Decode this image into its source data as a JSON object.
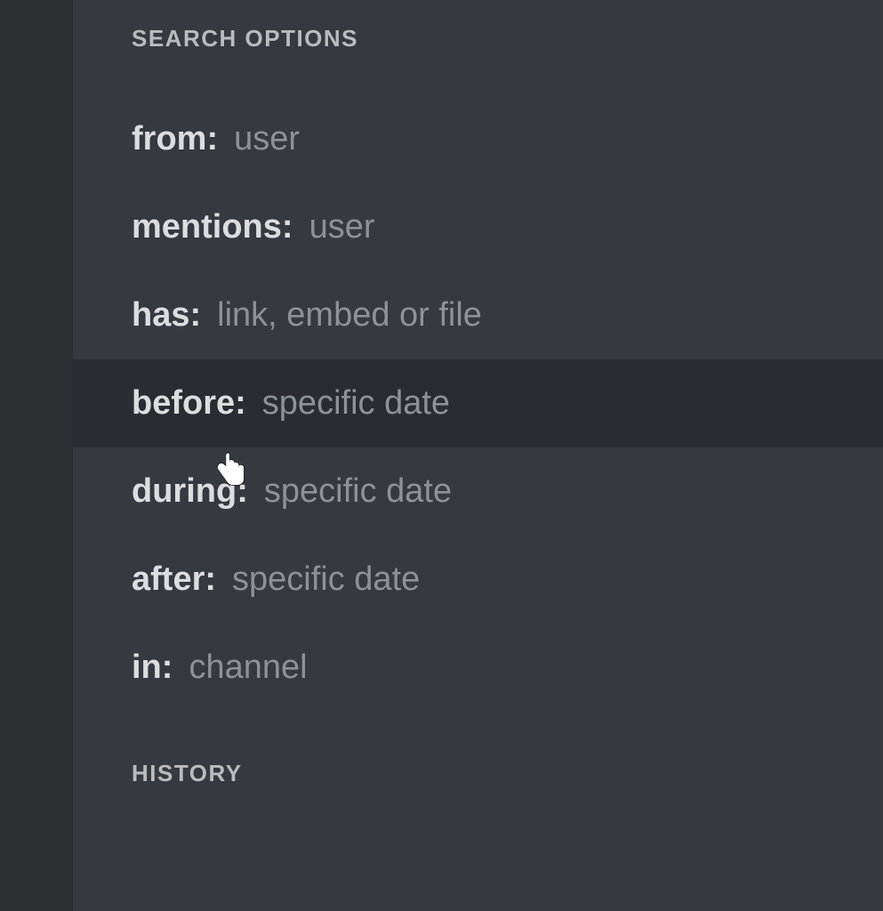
{
  "sections": {
    "search_options_header": "SEARCH OPTIONS",
    "history_header": "HISTORY"
  },
  "options": [
    {
      "key": "from:",
      "hint": "user",
      "hovered": false
    },
    {
      "key": "mentions:",
      "hint": "user",
      "hovered": false
    },
    {
      "key": "has:",
      "hint": "link, embed or file",
      "hovered": false
    },
    {
      "key": "before:",
      "hint": "specific date",
      "hovered": true
    },
    {
      "key": "during:",
      "hint": "specific date",
      "hovered": false
    },
    {
      "key": "after:",
      "hint": "specific date",
      "hovered": false
    },
    {
      "key": "in:",
      "hint": "channel",
      "hovered": false
    }
  ]
}
